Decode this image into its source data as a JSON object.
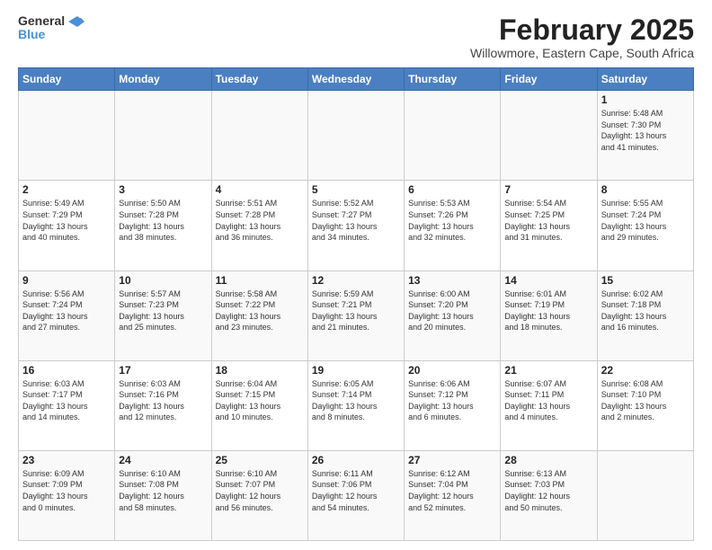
{
  "logo": {
    "line1": "General",
    "line2": "Blue"
  },
  "title": "February 2025",
  "subtitle": "Willowmore, Eastern Cape, South Africa",
  "days_header": [
    "Sunday",
    "Monday",
    "Tuesday",
    "Wednesday",
    "Thursday",
    "Friday",
    "Saturday"
  ],
  "weeks": [
    [
      {
        "day": "",
        "info": ""
      },
      {
        "day": "",
        "info": ""
      },
      {
        "day": "",
        "info": ""
      },
      {
        "day": "",
        "info": ""
      },
      {
        "day": "",
        "info": ""
      },
      {
        "day": "",
        "info": ""
      },
      {
        "day": "1",
        "info": "Sunrise: 5:48 AM\nSunset: 7:30 PM\nDaylight: 13 hours\nand 41 minutes."
      }
    ],
    [
      {
        "day": "2",
        "info": "Sunrise: 5:49 AM\nSunset: 7:29 PM\nDaylight: 13 hours\nand 40 minutes."
      },
      {
        "day": "3",
        "info": "Sunrise: 5:50 AM\nSunset: 7:28 PM\nDaylight: 13 hours\nand 38 minutes."
      },
      {
        "day": "4",
        "info": "Sunrise: 5:51 AM\nSunset: 7:28 PM\nDaylight: 13 hours\nand 36 minutes."
      },
      {
        "day": "5",
        "info": "Sunrise: 5:52 AM\nSunset: 7:27 PM\nDaylight: 13 hours\nand 34 minutes."
      },
      {
        "day": "6",
        "info": "Sunrise: 5:53 AM\nSunset: 7:26 PM\nDaylight: 13 hours\nand 32 minutes."
      },
      {
        "day": "7",
        "info": "Sunrise: 5:54 AM\nSunset: 7:25 PM\nDaylight: 13 hours\nand 31 minutes."
      },
      {
        "day": "8",
        "info": "Sunrise: 5:55 AM\nSunset: 7:24 PM\nDaylight: 13 hours\nand 29 minutes."
      }
    ],
    [
      {
        "day": "9",
        "info": "Sunrise: 5:56 AM\nSunset: 7:24 PM\nDaylight: 13 hours\nand 27 minutes."
      },
      {
        "day": "10",
        "info": "Sunrise: 5:57 AM\nSunset: 7:23 PM\nDaylight: 13 hours\nand 25 minutes."
      },
      {
        "day": "11",
        "info": "Sunrise: 5:58 AM\nSunset: 7:22 PM\nDaylight: 13 hours\nand 23 minutes."
      },
      {
        "day": "12",
        "info": "Sunrise: 5:59 AM\nSunset: 7:21 PM\nDaylight: 13 hours\nand 21 minutes."
      },
      {
        "day": "13",
        "info": "Sunrise: 6:00 AM\nSunset: 7:20 PM\nDaylight: 13 hours\nand 20 minutes."
      },
      {
        "day": "14",
        "info": "Sunrise: 6:01 AM\nSunset: 7:19 PM\nDaylight: 13 hours\nand 18 minutes."
      },
      {
        "day": "15",
        "info": "Sunrise: 6:02 AM\nSunset: 7:18 PM\nDaylight: 13 hours\nand 16 minutes."
      }
    ],
    [
      {
        "day": "16",
        "info": "Sunrise: 6:03 AM\nSunset: 7:17 PM\nDaylight: 13 hours\nand 14 minutes."
      },
      {
        "day": "17",
        "info": "Sunrise: 6:03 AM\nSunset: 7:16 PM\nDaylight: 13 hours\nand 12 minutes."
      },
      {
        "day": "18",
        "info": "Sunrise: 6:04 AM\nSunset: 7:15 PM\nDaylight: 13 hours\nand 10 minutes."
      },
      {
        "day": "19",
        "info": "Sunrise: 6:05 AM\nSunset: 7:14 PM\nDaylight: 13 hours\nand 8 minutes."
      },
      {
        "day": "20",
        "info": "Sunrise: 6:06 AM\nSunset: 7:12 PM\nDaylight: 13 hours\nand 6 minutes."
      },
      {
        "day": "21",
        "info": "Sunrise: 6:07 AM\nSunset: 7:11 PM\nDaylight: 13 hours\nand 4 minutes."
      },
      {
        "day": "22",
        "info": "Sunrise: 6:08 AM\nSunset: 7:10 PM\nDaylight: 13 hours\nand 2 minutes."
      }
    ],
    [
      {
        "day": "23",
        "info": "Sunrise: 6:09 AM\nSunset: 7:09 PM\nDaylight: 13 hours\nand 0 minutes."
      },
      {
        "day": "24",
        "info": "Sunrise: 6:10 AM\nSunset: 7:08 PM\nDaylight: 12 hours\nand 58 minutes."
      },
      {
        "day": "25",
        "info": "Sunrise: 6:10 AM\nSunset: 7:07 PM\nDaylight: 12 hours\nand 56 minutes."
      },
      {
        "day": "26",
        "info": "Sunrise: 6:11 AM\nSunset: 7:06 PM\nDaylight: 12 hours\nand 54 minutes."
      },
      {
        "day": "27",
        "info": "Sunrise: 6:12 AM\nSunset: 7:04 PM\nDaylight: 12 hours\nand 52 minutes."
      },
      {
        "day": "28",
        "info": "Sunrise: 6:13 AM\nSunset: 7:03 PM\nDaylight: 12 hours\nand 50 minutes."
      },
      {
        "day": "",
        "info": ""
      }
    ]
  ]
}
